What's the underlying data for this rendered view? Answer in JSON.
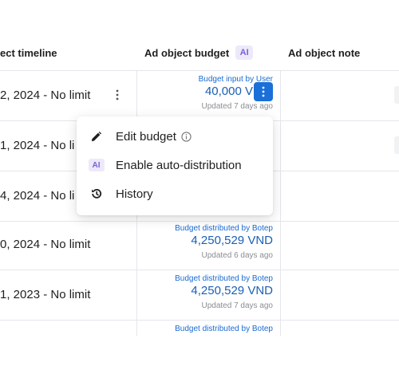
{
  "columns": {
    "timeline": "ect timeline",
    "budget": "Ad object budget",
    "budget_badge": "AI",
    "note": "Ad object note"
  },
  "rows": [
    {
      "timeline": "2, 2024 - No limit",
      "budget_source": "Budget input by User",
      "budget_value": "40,000 V",
      "budget_updated": "Updated 7 days ago"
    },
    {
      "timeline": "1, 2024 - No li",
      "budget_source": "",
      "budget_value": "",
      "budget_updated": ""
    },
    {
      "timeline": "4, 2024 - No li",
      "budget_source": "",
      "budget_value": "",
      "budget_updated": ""
    },
    {
      "timeline": "0, 2024 - No limit",
      "budget_source": "Budget distributed by Botep",
      "budget_value": "4,250,529 VND",
      "budget_updated": "Updated 6 days ago"
    },
    {
      "timeline": "1, 2023 - No limit",
      "budget_source": "Budget distributed by Botep",
      "budget_value": "4,250,529 VND",
      "budget_updated": "Updated 7 days ago"
    },
    {
      "timeline": "",
      "budget_source": "Budget distributed by Botep",
      "budget_value": "",
      "budget_updated": ""
    }
  ],
  "menu": {
    "items": [
      {
        "label": "Edit budget",
        "icon": "pencil-icon"
      },
      {
        "label": "Enable auto-distribution",
        "icon": "ai-badge-icon",
        "badge": "AI"
      },
      {
        "label": "History",
        "icon": "history-icon"
      }
    ]
  },
  "colors": {
    "link_blue": "#1a5fb4",
    "accent_blue": "#1b6fd8",
    "ai_purple": "#7b61d8",
    "ai_bg": "#ede9fb",
    "border": "#e4e6eb"
  }
}
